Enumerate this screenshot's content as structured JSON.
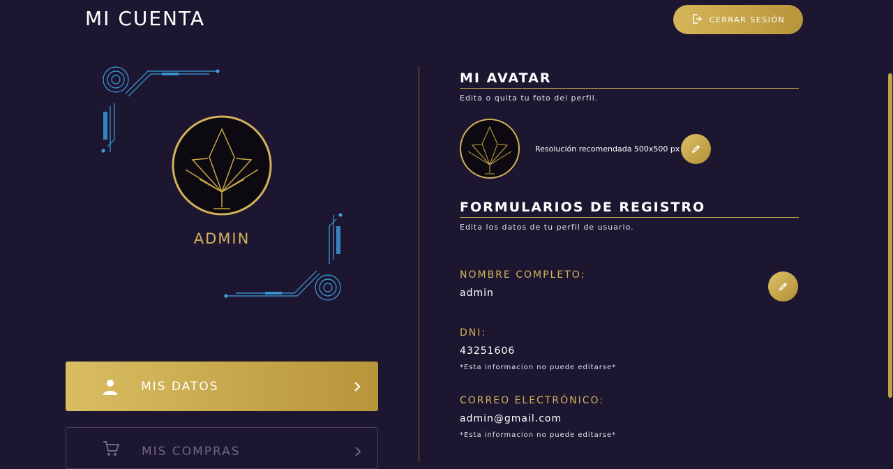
{
  "header": {
    "title": "MI CUENTA",
    "logout_label": "CERRAR SESIÓN"
  },
  "profile": {
    "name": "ADMIN"
  },
  "menu": {
    "items": [
      {
        "label": "MIS DATOS",
        "icon": "user-icon",
        "active": true
      },
      {
        "label": "MIS COMPRAS",
        "icon": "cart-icon",
        "active": false
      }
    ]
  },
  "avatar_section": {
    "title": "MI AVATAR",
    "subtitle": "Edita o quita tu foto del perfil.",
    "resolution_text": "Resolución recomendada 500x500 px"
  },
  "form_section": {
    "title": "FORMULARIOS DE REGISTRO",
    "subtitle": "Edita los datos de tu perfil de usuario.",
    "fields": [
      {
        "label": "NOMBRE COMPLETO:",
        "value": "admin",
        "note": ""
      },
      {
        "label": "DNI:",
        "value": "43251606",
        "note": "*Esta informacion no puede editarse*"
      },
      {
        "label": "CORREO ELECTRÓNICO:",
        "value": "admin@gmail.com",
        "note": "*Esta informacion no puede editarse*"
      }
    ]
  },
  "colors": {
    "background": "#1c1630",
    "gold": "#d4b25a",
    "circuit_blue": "#3fa0e0"
  }
}
